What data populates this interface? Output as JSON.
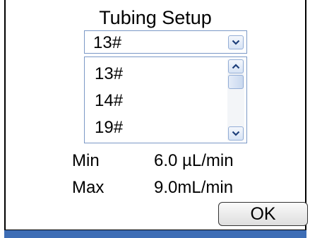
{
  "dialog": {
    "title": "Tubing Setup"
  },
  "tubing": {
    "selected": "13#",
    "options": [
      "13#",
      "14#",
      "19#"
    ]
  },
  "specs": {
    "min_label": "Min",
    "min_value": "6.0 µL/min",
    "max_label": "Max",
    "max_value": "9.0mL/min"
  },
  "buttons": {
    "ok_label": "OK"
  },
  "icons": {
    "dropdown": "chevron-down-icon",
    "scroll_up": "chevron-up-icon",
    "scroll_down": "chevron-down-icon"
  },
  "colors": {
    "control_border": "#7b98c6",
    "chevron": "#1e3f7a",
    "bottom_bar": "#3d6db5"
  }
}
